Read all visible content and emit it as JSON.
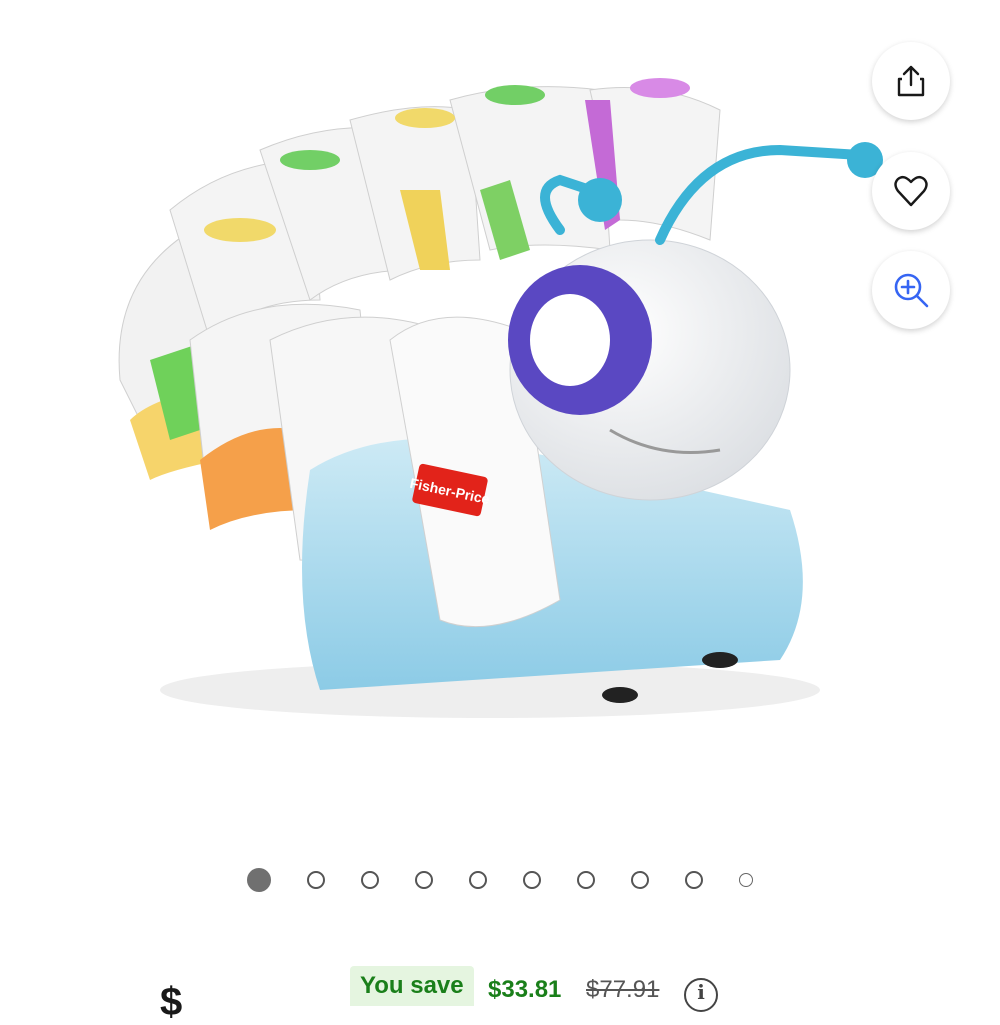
{
  "gallery": {
    "image_alt": "Fisher-Price Code-a-pillar toy",
    "brand_logo_text": "Fisher-Price",
    "icons": {
      "share": "share-icon",
      "favorite": "heart-icon",
      "zoom": "zoom-in-icon"
    },
    "pagination": {
      "total": 10,
      "active_index": 0
    }
  },
  "pricing": {
    "price": "$",
    "you_save_label": "You save",
    "save_amount": "$33.81",
    "original_price": "$77.91",
    "info_icon": "info-icon"
  },
  "colors": {
    "save_green": "#1a7f1a",
    "save_bg": "#e5f5e0",
    "icon_blue": "#3665f3"
  }
}
